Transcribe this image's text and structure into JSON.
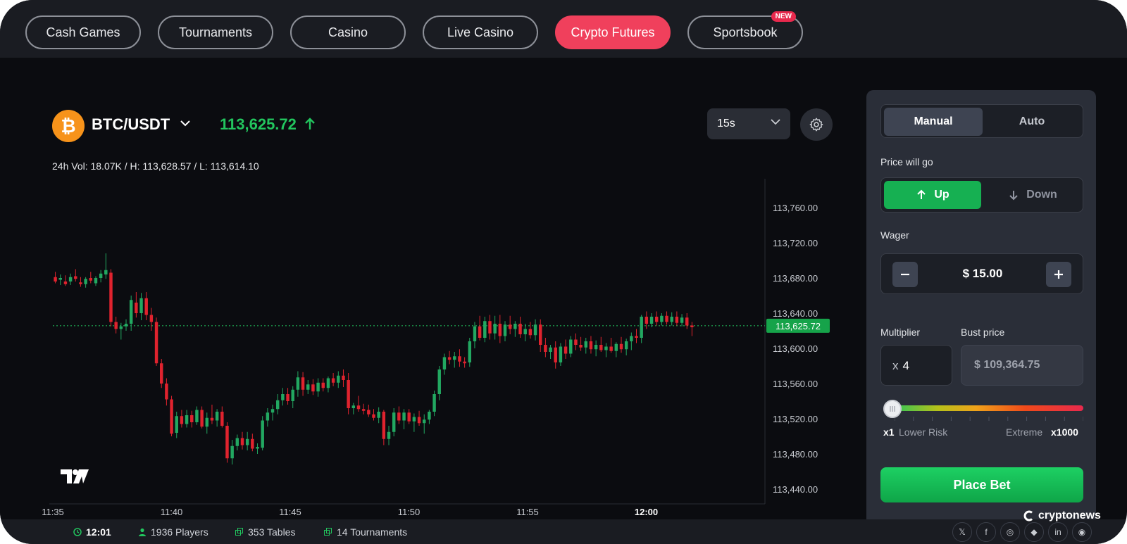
{
  "nav": {
    "items": [
      {
        "label": "Cash Games"
      },
      {
        "label": "Tournaments"
      },
      {
        "label": "Casino"
      },
      {
        "label": "Live Casino"
      },
      {
        "label": "Crypto Futures",
        "active": true
      },
      {
        "label": "Sportsbook",
        "badge": "NEW"
      }
    ]
  },
  "ticker": {
    "pair": "BTC/USDT",
    "logo_glyph": "₿",
    "price": "113,625.72",
    "stats": "24h Vol: 18.07K / H: 113,628.57 / L: 113,614.10",
    "interval": "15s"
  },
  "chart_data": {
    "type": "candlestick",
    "x_tick_labels": [
      "11:35",
      "11:40",
      "11:45",
      "11:50",
      "11:55",
      "12:00"
    ],
    "x_tick_minutes": [
      0,
      5,
      10,
      15,
      20,
      25
    ],
    "y_tick_labels": [
      "113,760.00",
      "113,720.00",
      "113,680.00",
      "113,640.00",
      "113,600.00",
      "113,560.00",
      "113,520.00",
      "113,480.00",
      "113,440.00"
    ],
    "ylim": [
      113428,
      113790
    ],
    "xlim_minutes": [
      0,
      30
    ],
    "current_price": 113625.72,
    "current_price_label": "113,625.72",
    "colors": {
      "up": "#22a861",
      "down": "#e0232e",
      "price_line": "#22c55e"
    },
    "ohlc": [
      [
        113681,
        113687,
        113674,
        113676
      ],
      [
        113678,
        113684,
        113672,
        113680
      ],
      [
        113676,
        113683,
        113671,
        113673
      ],
      [
        113676,
        113685,
        113672,
        113681
      ],
      [
        113682,
        113690,
        113676,
        113679
      ],
      [
        113675,
        113681,
        113670,
        113673
      ],
      [
        113673,
        113681,
        113669,
        113679
      ],
      [
        113680,
        113687,
        113674,
        113677
      ],
      [
        113674,
        113682,
        113671,
        113680
      ],
      [
        113680,
        113689,
        113675,
        113685
      ],
      [
        113684,
        113708,
        113679,
        113689
      ],
      [
        113686,
        113690,
        113625,
        113630
      ],
      [
        113630,
        113636,
        113617,
        113622
      ],
      [
        113622,
        113629,
        113610,
        113625
      ],
      [
        113625,
        113633,
        113620,
        113628
      ],
      [
        113628,
        113660,
        113620,
        113655
      ],
      [
        113652,
        113664,
        113635,
        113640
      ],
      [
        113640,
        113663,
        113632,
        113657
      ],
      [
        113657,
        113664,
        113632,
        113638
      ],
      [
        113638,
        113646,
        113620,
        113630
      ],
      [
        113630,
        113635,
        113580,
        113583
      ],
      [
        113583,
        113588,
        113555,
        113560
      ],
      [
        113560,
        113566,
        113535,
        113542
      ],
      [
        113542,
        113546,
        113500,
        113503
      ],
      [
        113504,
        113528,
        113498,
        113523
      ],
      [
        113523,
        113530,
        113510,
        113514
      ],
      [
        113514,
        113530,
        113510,
        113524
      ],
      [
        113524,
        113529,
        113510,
        113516
      ],
      [
        113516,
        113534,
        113513,
        113530
      ],
      [
        113530,
        113534,
        113509,
        113511
      ],
      [
        113511,
        113527,
        113503,
        113521
      ],
      [
        113521,
        113536,
        113514,
        113518
      ],
      [
        113518,
        113531,
        113511,
        113528
      ],
      [
        113528,
        113534,
        113510,
        113512
      ],
      [
        113512,
        113516,
        113470,
        113475
      ],
      [
        113475,
        113496,
        113468,
        113489
      ],
      [
        113489,
        113502,
        113484,
        113498
      ],
      [
        113498,
        113505,
        113485,
        113490
      ],
      [
        113490,
        113505,
        113484,
        113497
      ],
      [
        113497,
        113503,
        113483,
        113486
      ],
      [
        113486,
        113492,
        113480,
        113488
      ],
      [
        113487,
        113523,
        113484,
        113518
      ],
      [
        113518,
        113532,
        113511,
        113527
      ],
      [
        113527,
        113536,
        113518,
        113531
      ],
      [
        113531,
        113548,
        113525,
        113541
      ],
      [
        113541,
        113555,
        113535,
        113548
      ],
      [
        113548,
        113555,
        113536,
        113540
      ],
      [
        113540,
        113557,
        113532,
        113553
      ],
      [
        113553,
        113574,
        113545,
        113567
      ],
      [
        113567,
        113573,
        113546,
        113553
      ],
      [
        113553,
        113564,
        113548,
        113559
      ],
      [
        113559,
        113565,
        113547,
        113551
      ],
      [
        113551,
        113566,
        113545,
        113561
      ],
      [
        113561,
        113566,
        113551,
        113555
      ],
      [
        113555,
        113568,
        113550,
        113566
      ],
      [
        113566,
        113572,
        113557,
        113561
      ],
      [
        113561,
        113574,
        113555,
        113569
      ],
      [
        113569,
        113576,
        113556,
        113564
      ],
      [
        113564,
        113572,
        113525,
        113532
      ],
      [
        113532,
        113538,
        113525,
        113535
      ],
      [
        113535,
        113546,
        113528,
        113531
      ],
      [
        113531,
        113537,
        113525,
        113529
      ],
      [
        113530,
        113536,
        113522,
        113525
      ],
      [
        113525,
        113531,
        113518,
        113521
      ],
      [
        113521,
        113533,
        113515,
        113528
      ],
      [
        113528,
        113530,
        113490,
        113497
      ],
      [
        113497,
        113512,
        113490,
        113505
      ],
      [
        113505,
        113532,
        113500,
        113527
      ],
      [
        113527,
        113534,
        113514,
        113518
      ],
      [
        113518,
        113531,
        113508,
        113527
      ],
      [
        113527,
        113531,
        113514,
        113517
      ],
      [
        113517,
        113526,
        113505,
        113522
      ],
      [
        113522,
        113529,
        113512,
        113515
      ],
      [
        113515,
        113525,
        113503,
        113519
      ],
      [
        113519,
        113530,
        113514,
        113528
      ],
      [
        113528,
        113552,
        113523,
        113548
      ],
      [
        113548,
        113580,
        113541,
        113576
      ],
      [
        113576,
        113594,
        113570,
        113590
      ],
      [
        113590,
        113597,
        113582,
        113587
      ],
      [
        113587,
        113596,
        113578,
        113591
      ],
      [
        113591,
        113599,
        113579,
        113585
      ],
      [
        113585,
        113590,
        113578,
        113583
      ],
      [
        113584,
        113612,
        113579,
        113608
      ],
      [
        113608,
        113630,
        113600,
        113625
      ],
      [
        113625,
        113637,
        113609,
        113612
      ],
      [
        113612,
        113636,
        113607,
        113631
      ],
      [
        113631,
        113638,
        113610,
        113617
      ],
      [
        113617,
        113637,
        113610,
        113628
      ],
      [
        113628,
        113638,
        113606,
        113614
      ],
      [
        113614,
        113631,
        113608,
        113627
      ],
      [
        113627,
        113637,
        113616,
        113622
      ],
      [
        113622,
        113631,
        113613,
        113628
      ],
      [
        113628,
        113636,
        113612,
        113616
      ],
      [
        113616,
        113628,
        113608,
        113622
      ],
      [
        113622,
        113630,
        113611,
        113615
      ],
      [
        113615,
        113633,
        113609,
        113627
      ],
      [
        113627,
        113633,
        113596,
        113604
      ],
      [
        113604,
        113612,
        113590,
        113596
      ],
      [
        113596,
        113604,
        113588,
        113601
      ],
      [
        113601,
        113608,
        113577,
        113584
      ],
      [
        113584,
        113606,
        113580,
        113602
      ],
      [
        113602,
        113610,
        113588,
        113594
      ],
      [
        113594,
        113614,
        113590,
        113610
      ],
      [
        113610,
        113617,
        113598,
        113604
      ],
      [
        113604,
        113613,
        113597,
        113601
      ],
      [
        113601,
        113612,
        113594,
        113608
      ],
      [
        113608,
        113614,
        113594,
        113599
      ],
      [
        113599,
        113609,
        113591,
        113604
      ],
      [
        113604,
        113613,
        113596,
        113598
      ],
      [
        113598,
        113606,
        113590,
        113602
      ],
      [
        113602,
        113612,
        113595,
        113597
      ],
      [
        113597,
        113607,
        113590,
        113605
      ],
      [
        113605,
        113613,
        113595,
        113599
      ],
      [
        113599,
        113611,
        113592,
        113608
      ],
      [
        113608,
        113618,
        113598,
        113614
      ],
      [
        113614,
        113622,
        113606,
        113612
      ],
      [
        113612,
        113638,
        113606,
        113636
      ],
      [
        113636,
        113642,
        113622,
        113628
      ],
      [
        113628,
        113640,
        113624,
        113636
      ],
      [
        113636,
        113642,
        113626,
        113630
      ],
      [
        113630,
        113640,
        113626,
        113637
      ],
      [
        113637,
        113642,
        113627,
        113630
      ],
      [
        113630,
        113641,
        113626,
        113636
      ],
      [
        113636,
        113642,
        113626,
        113629
      ],
      [
        113629,
        113639,
        113625,
        113635
      ],
      [
        113635,
        113640,
        113622,
        113626
      ],
      [
        113626,
        113630,
        113614,
        113624
      ]
    ]
  },
  "panel": {
    "tabs": [
      "Manual",
      "Auto"
    ],
    "price_label": "Price will go",
    "up_label": "Up",
    "down_label": "Down",
    "wager_label": "Wager",
    "wager_value": "$ 15.00",
    "multiplier_label": "Multiplier",
    "bust_label": "Bust price",
    "multiplier_prefix": "x",
    "multiplier_value": "4",
    "bust_value": "$ 109,364.75",
    "risk_min": "x1",
    "risk_min_label": "Lower Risk",
    "risk_max_label": "Extreme",
    "risk_max": "x1000",
    "slider_level": 0,
    "place_bet": "Place Bet"
  },
  "footer": {
    "time": "12:01",
    "players": "1936 Players",
    "tables": "353 Tables",
    "tournaments": "14 Tournaments",
    "watermark": "cryptonews",
    "socials": [
      "𝕏",
      "f",
      "◎",
      "◆",
      "in",
      "◉"
    ]
  }
}
